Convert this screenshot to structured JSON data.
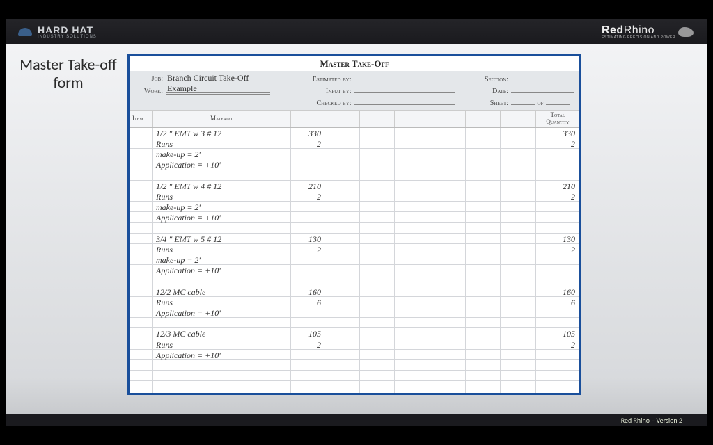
{
  "slide_title_line1": "Master Take-off",
  "slide_title_line2": "form",
  "brand_left": {
    "name": "HARD HAT",
    "sub": "INDUSTRY SOLUTIONS"
  },
  "brand_right": {
    "name_red": "Red",
    "name_rest": "Rhino",
    "sub": "ESTIMATING PRECISION AND POWER"
  },
  "footer": "Red Rhino – Version 2",
  "form": {
    "title": "Master Take-Off",
    "meta": {
      "job_label": "Job:",
      "job_value": "Branch Circuit Take-Off Example",
      "work_label": "Work:",
      "work_value": "",
      "estimated_label": "Estimated by:",
      "estimated_value": "",
      "input_label": "Input by:",
      "input_value": "",
      "checked_label": "Checked by:",
      "checked_value": "",
      "section_label": "Section:",
      "section_value": "",
      "date_label": "Date:",
      "date_value": "",
      "sheet_label": "Sheet:",
      "sheet_value": "",
      "sheet_of_label": "of",
      "sheet_of_value": ""
    },
    "columns": {
      "item": "Item",
      "material": "Material",
      "total": "Total Quantity"
    },
    "rows": [
      {
        "material": "1/2 \" EMT w 3 # 12",
        "num": "330",
        "total": "330"
      },
      {
        "material": "Runs",
        "num": "2",
        "total": "2"
      },
      {
        "material": "make-up = 2'",
        "num": "",
        "total": ""
      },
      {
        "material": "Application = +10'",
        "num": "",
        "total": ""
      },
      {
        "material": "",
        "num": "",
        "total": ""
      },
      {
        "material": "1/2 \" EMT w 4 # 12",
        "num": "210",
        "total": "210"
      },
      {
        "material": "Runs",
        "num": "2",
        "total": "2"
      },
      {
        "material": "make-up = 2'",
        "num": "",
        "total": ""
      },
      {
        "material": "Application = +10'",
        "num": "",
        "total": ""
      },
      {
        "material": "",
        "num": "",
        "total": ""
      },
      {
        "material": "3/4 \" EMT w 5 # 12",
        "num": "130",
        "total": "130"
      },
      {
        "material": "Runs",
        "num": "2",
        "total": "2"
      },
      {
        "material": "make-up = 2'",
        "num": "",
        "total": ""
      },
      {
        "material": "Application = +10'",
        "num": "",
        "total": ""
      },
      {
        "material": "",
        "num": "",
        "total": ""
      },
      {
        "material": "12/2 MC cable",
        "num": "160",
        "total": "160"
      },
      {
        "material": "Runs",
        "num": "6",
        "total": "6"
      },
      {
        "material": "Application = +10'",
        "num": "",
        "total": ""
      },
      {
        "material": "",
        "num": "",
        "total": ""
      },
      {
        "material": "12/3 MC cable",
        "num": "105",
        "total": "105"
      },
      {
        "material": "Runs",
        "num": "2",
        "total": "2"
      },
      {
        "material": "Application = +10'",
        "num": "",
        "total": ""
      },
      {
        "material": "",
        "num": "",
        "total": ""
      },
      {
        "material": "",
        "num": "",
        "total": ""
      },
      {
        "material": "",
        "num": "",
        "total": ""
      },
      {
        "material": "",
        "num": "",
        "total": ""
      }
    ]
  }
}
